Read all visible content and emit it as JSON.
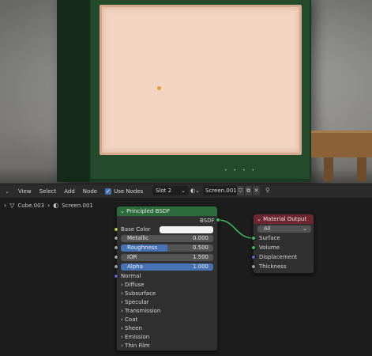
{
  "colors": {
    "bsdf_header": "#2b6b3c",
    "output_header": "#6e2630",
    "field_fill": "#4772b3",
    "socket_shader": "#3fbf5f",
    "socket_color": "#c7c729",
    "socket_value": "#a1a1a1",
    "socket_vector": "#6363c7",
    "screen_emission": "#f2d4c1"
  },
  "header": {
    "editor_type_icon": "chevron-down-icon",
    "menus": [
      "View",
      "Select",
      "Add",
      "Node"
    ],
    "use_nodes_label": "Use Nodes",
    "use_nodes_checked": true,
    "slot_label": "Slot 2",
    "material_name": "Screen.001"
  },
  "breadcrumb": {
    "object": "Cube.003",
    "material": "Screen.001"
  },
  "bsdf_node": {
    "title": "Principled BSDF",
    "output_label": "BSDF",
    "base_color_label": "Base Color",
    "base_color_value": "#f2f2f2",
    "metallic_label": "Metallic",
    "metallic_value": "0.000",
    "roughness_label": "Roughness",
    "roughness_value": "0.500",
    "ior_label": "IOR",
    "ior_value": "1.500",
    "alpha_label": "Alpha",
    "alpha_value": "1.000",
    "normal_label": "Normal",
    "panels": [
      "Diffuse",
      "Subsurface",
      "Specular",
      "Transmission",
      "Coat",
      "Sheen",
      "Emission",
      "Thin Film"
    ]
  },
  "output_node": {
    "title": "Material Output",
    "target": "All",
    "inputs": [
      "Surface",
      "Volume",
      "Displacement",
      "Thickness"
    ]
  }
}
